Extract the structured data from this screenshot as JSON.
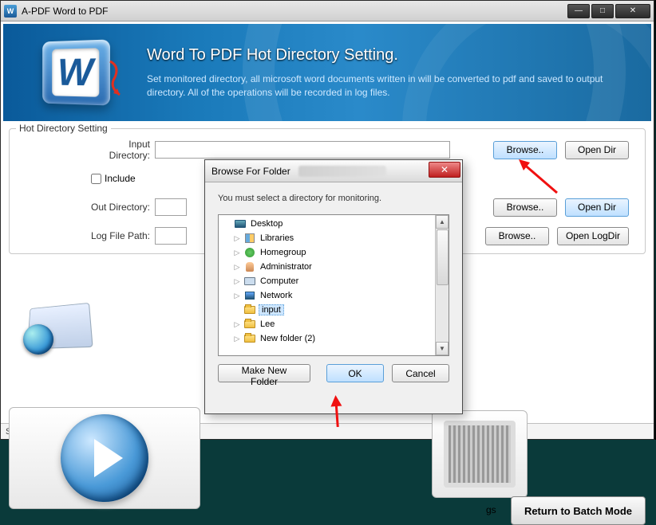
{
  "titlebar": {
    "title": "A-PDF Word to PDF"
  },
  "banner": {
    "heading": "Word To PDF Hot Directory Setting.",
    "sub": "Set monitored directory, all microsoft word documents written in will be converted to pdf and saved to output directory. All of the operations will be recorded in log files."
  },
  "group": {
    "title": "Hot Directory Setting",
    "input_label": "Input Directory:",
    "input_val": "",
    "include_label": "Include",
    "out_label": "Out Directory:",
    "out_val": "",
    "log_label": "Log File Path:",
    "log_val": "",
    "browse": "Browse..",
    "open_dir": "Open Dir",
    "open_logdir": "Open LogDir"
  },
  "bottom": {
    "return_label": "Return to Batch Mode",
    "settings_fragment": "gs"
  },
  "status": "Server Stopped",
  "dialog": {
    "title": "Browse For Folder",
    "msg": "You must select a directory for monitoring.",
    "nodes": {
      "desktop": "Desktop",
      "libraries": "Libraries",
      "homegroup": "Homegroup",
      "admin": "Administrator",
      "computer": "Computer",
      "network": "Network",
      "input": "input",
      "lee": "Lee",
      "newfolder": "New folder (2)"
    },
    "make": "Make New Folder",
    "ok": "OK",
    "cancel": "Cancel"
  }
}
